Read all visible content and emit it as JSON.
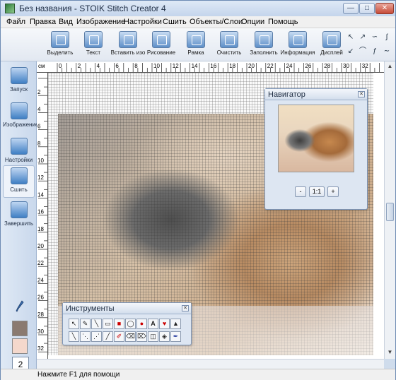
{
  "window": {
    "title": "Без названия - STOIK Stitch Creator 4",
    "min": "—",
    "max": "□",
    "close": "✕"
  },
  "menu": [
    "Файл",
    "Правка",
    "Вид",
    "Изображение",
    "Настройки",
    "Сшить",
    "Объекты/Слои",
    "Опции",
    "Помощь"
  ],
  "toolbar": {
    "buttons": [
      {
        "label": "Выделить",
        "icon": "select-icon"
      },
      {
        "label": "Текст",
        "icon": "text-icon"
      },
      {
        "label": "Вставить изо",
        "icon": "insert-image-icon"
      },
      {
        "label": "Рисование",
        "icon": "draw-icon"
      },
      {
        "label": "Рамка",
        "icon": "frame-icon"
      },
      {
        "label": "Очистить",
        "icon": "clear-icon"
      },
      {
        "label": "Заполнить",
        "icon": "fill-icon"
      },
      {
        "label": "Информация",
        "icon": "info-icon"
      },
      {
        "label": "Дисплей",
        "icon": "display-icon"
      }
    ]
  },
  "sidebar": {
    "items": [
      {
        "label": "Запуск",
        "icon": "start-icon"
      },
      {
        "label": "Изображение",
        "icon": "image-icon"
      },
      {
        "label": "Настройки",
        "icon": "settings-icon"
      },
      {
        "label": "Сшить",
        "icon": "stitch-icon"
      },
      {
        "label": "Завершить",
        "icon": "finish-icon"
      }
    ],
    "page_number": "2",
    "swatch_colors": [
      "#8a7a70",
      "#f4d8cc"
    ]
  },
  "rulers": {
    "unit": "см",
    "top_labels": [
      "0",
      "2",
      "4",
      "6",
      "8",
      "10",
      "12",
      "14",
      "16",
      "18",
      "20",
      "22",
      "24",
      "26",
      "28",
      "30",
      "32",
      "34"
    ],
    "left_labels": [
      "2",
      "4",
      "6",
      "8",
      "10",
      "12",
      "14",
      "16",
      "18",
      "20",
      "22",
      "24",
      "26",
      "28",
      "30",
      "32"
    ]
  },
  "navigator": {
    "title": "Навигатор",
    "zoom_out": "-",
    "zoom_reset": "1:1",
    "zoom_in": "+"
  },
  "tools_panel": {
    "title": "Инструменты"
  },
  "status": {
    "text": "Нажмите F1 для помощи"
  }
}
